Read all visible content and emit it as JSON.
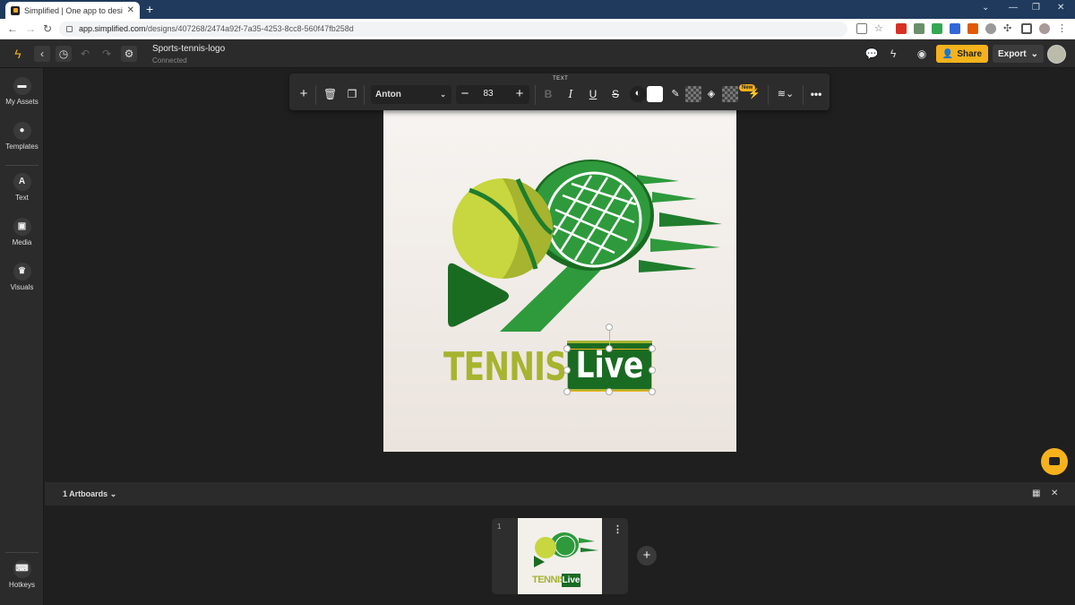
{
  "browser": {
    "tab_title": "Simplified | One app to design, c",
    "url_host": "app.simplified.com",
    "url_path": "/designs/407268/2474a92f-7a35-4253-8cc8-560f47fb258d"
  },
  "header": {
    "doc_name": "Sports-tennis-logo",
    "doc_status": "Connected",
    "share_label": "Share",
    "export_label": "Export"
  },
  "sidebar": {
    "items": [
      {
        "label": "My Assets",
        "icon": "folder-icon"
      },
      {
        "label": "Templates",
        "icon": "drop-icon"
      },
      {
        "label": "Text",
        "glyph": "A",
        "icon": "text-icon"
      },
      {
        "label": "Media",
        "icon": "image-icon"
      },
      {
        "label": "Visuals",
        "icon": "crown-icon"
      }
    ],
    "hotkeys_label": "Hotkeys"
  },
  "toolbar": {
    "section_label": "TEXT",
    "font_name": "Anton",
    "font_size": "83",
    "bold": "B",
    "italic": "I",
    "underline": "U",
    "strike": "S",
    "new_badge": "New"
  },
  "design": {
    "word1": "TENNIS",
    "word2": "Live",
    "thumb_word1": "TENNIS",
    "thumb_word2": "Live"
  },
  "artboards": {
    "title": "1 Artboards",
    "items": [
      {
        "number": "1"
      }
    ]
  },
  "colors": {
    "accent": "#f5b21c",
    "logo_green_dark": "#1a6b22",
    "logo_green": "#2e9a3c",
    "logo_olive": "#a6b42f",
    "ball_yellow": "#c8d63f"
  }
}
